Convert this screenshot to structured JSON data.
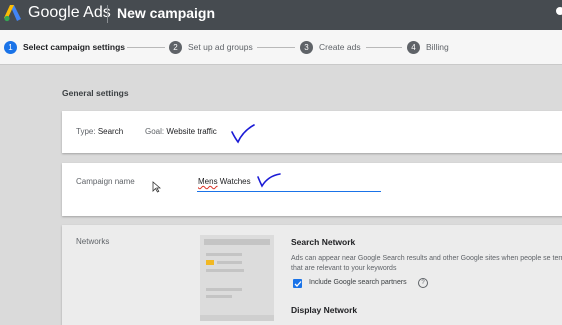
{
  "appbar": {
    "brand": "Google Ads",
    "title": "New campaign"
  },
  "steps": [
    {
      "num": "1",
      "label": "Select campaign settings",
      "active": true
    },
    {
      "num": "2",
      "label": "Set up ad groups",
      "active": false
    },
    {
      "num": "3",
      "label": "Create ads",
      "active": false
    },
    {
      "num": "4",
      "label": "Billing",
      "active": false
    }
  ],
  "general": {
    "section_title": "General settings",
    "type_label": "Type:",
    "type_value": "Search",
    "goal_label": "Goal:",
    "goal_value": "Website traffic"
  },
  "campaign_name": {
    "label": "Campaign name",
    "value": "Mens Watches",
    "value_misspelled": "Mens",
    "value_rest": " Watches"
  },
  "networks": {
    "label": "Networks",
    "search_title": "Search Network",
    "search_desc": "Ads can appear near Google Search results and other Google sites when people se terms that are relevant to your keywords",
    "partners_label": "Include Google search partners",
    "partners_checked": true,
    "display_title": "Display Network"
  },
  "colors": {
    "accent": "#1a73e8",
    "appbar": "#464b50",
    "handwritten_check": "#1b1bd6"
  }
}
